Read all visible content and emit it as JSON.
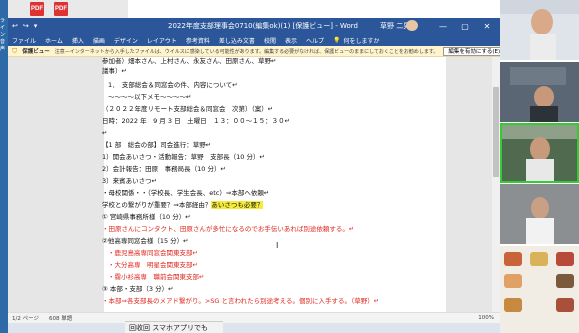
{
  "desktop": {
    "icon1": "PDF",
    "icon2": "PDF",
    "left_label": "ライン音声"
  },
  "window": {
    "title": "2022年度支部理事会0710(編集ok)(1) [保護ビュー] - Word",
    "user": "草野 二男",
    "controls": [
      "—",
      "▢",
      "✕"
    ],
    "quick_access": [
      "↩",
      "↪",
      "▾"
    ]
  },
  "ribbon": {
    "tabs": [
      "ファイル",
      "ホーム",
      "挿入",
      "描画",
      "デザイン",
      "レイアウト",
      "参考資料",
      "差し込み文書",
      "校閲",
      "表示",
      "ヘルプ"
    ],
    "search_label": "何をしますか"
  },
  "protected_view": {
    "label": "保護ビュー",
    "message": "注意—インターネットから入手したファイルは、ウイルスに感染している可能性があります。編集する必要がなければ、保護ビューのままにしておくことをお勧めします。",
    "button": "編集を有効にする(E)"
  },
  "document": {
    "lines": [
      "参加者）畑本さん、上村さん、永友さん、田原さん、草野↵",
      "議事）↵",
      "1．　支部総会＆同窓会の件、内容について↵",
      "～～～～以下メモ～～～～↵",
      "（２０２２年度リモート支部総会＆同窓会　次第）（案）↵",
      "日時：2022 年　9 月 3 日　土曜日　１３：００～１５：３０↵",
      "↵",
      "【1 部　総会の部】司会進行：草野↵",
      "1）開会あいさつ・活動報告：草野　支部長（10 分）↵",
      "2）会計報告：田原　事務局長（10 分）↵",
      "3）来賓あいさつ↵",
      "・母校関係・・（学校長、学生会長、etc）⇒本部へ依頼↵",
      "学校との繋がりが重要？⇒本部経由？",
      "① 宮崎県事務所様（10 分）↵",
      "・田原さんにコンタクト、田原さんが多忙になるのでお手伝いあれば別途依頼する。↵",
      "②他高専同窓会様（15 分）↵",
      "・鹿児島高専同窓会関東支部↵",
      "・大分高専　明星会関東支部↵",
      "・霧小衫高専　職前会関東支部↵",
      "③ 本部・支部（3 分）↵",
      "・本部⇒各支部長のメアド繋がり。>SG と言われたら別途考える。個別に入手する。（草野）↵"
    ],
    "highlight_text": "あいさつも必要？"
  },
  "statusbar": {
    "page": "1/2 ページ",
    "words": "608 単語",
    "zoom": "100%"
  },
  "taskbar": {
    "caption": "回收回 スマホアプリでも"
  },
  "colors": {
    "word_blue": "#2b579a",
    "notice_yellow": "#fff4ce",
    "red_text": "#e0251b",
    "highlight": "#f7ec3a",
    "active_speaker": "#33cc33"
  }
}
